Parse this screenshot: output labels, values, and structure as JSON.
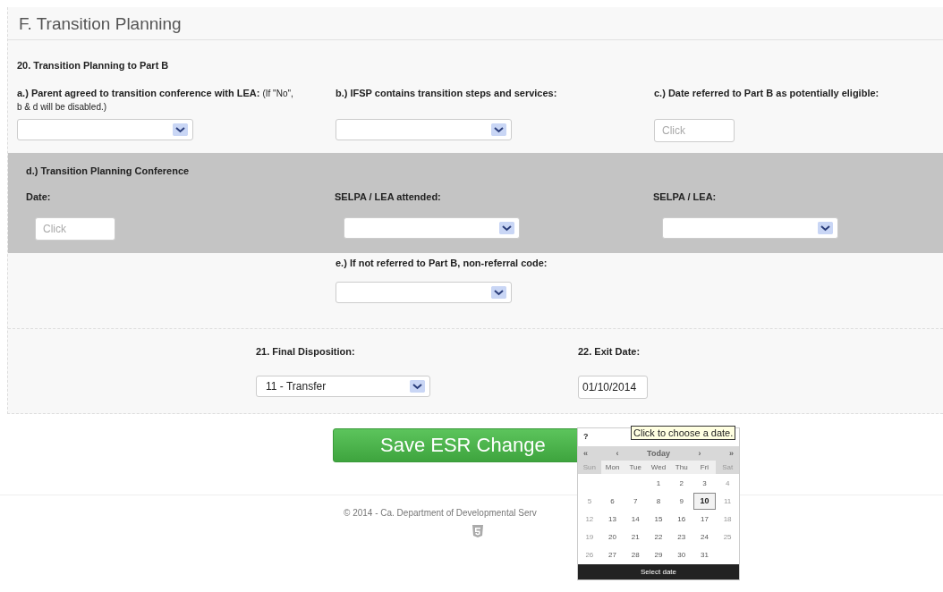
{
  "section_title": "F. Transition Planning",
  "question_20": {
    "title": "20. Transition Planning to Part B",
    "fields": [
      {
        "kind": "select",
        "label": "a.) Parent agreed to transition conference with LEA:",
        "note": "(If \"No\", b & d will be disabled.)"
      },
      {
        "kind": "select",
        "label": "b.) IFSP contains transition steps and services:"
      },
      {
        "kind": "date",
        "label": "c.) Date referred to Part B as potentially eligible:",
        "placeholder": "Click"
      }
    ]
  },
  "conference": {
    "title": "d.) Transition Planning Conference",
    "fields": [
      {
        "kind": "date",
        "label": "Date:",
        "placeholder": "Click"
      },
      {
        "kind": "select",
        "label": "SELPA / LEA attended:"
      },
      {
        "kind": "select",
        "label": "SELPA / LEA:"
      }
    ]
  },
  "non_referral": {
    "label": "e.) If not referred to Part B, non-referral code:"
  },
  "final_disposition": {
    "label": "21. Final Disposition:",
    "value": "11 - Transfer"
  },
  "exit_date": {
    "label": "22. Exit Date:",
    "value": "01/10/2014"
  },
  "save_button": "Save ESR Change",
  "footer": "© 2014 - Ca. Department of Developmental Serv",
  "tooltip": "Click to choose a date.",
  "calendar": {
    "help": "?",
    "nav": [
      "«",
      "‹",
      "Today",
      "›",
      "»"
    ],
    "weekdays": [
      {
        "label": "Sun",
        "weekend": true
      },
      {
        "label": "Mon",
        "weekend": false
      },
      {
        "label": "Tue",
        "weekend": false
      },
      {
        "label": "Wed",
        "weekend": false
      },
      {
        "label": "Thu",
        "weekend": false
      },
      {
        "label": "Fri",
        "weekend": false
      },
      {
        "label": "Sat",
        "weekend": true
      }
    ],
    "weeks": [
      {
        "days": [
          {
            "day": "1",
            "selected": false
          },
          {
            "day": "2",
            "selected": false
          },
          {
            "day": "3",
            "selected": false
          },
          {
            "day": "4",
            "selected": false
          }
        ]
      },
      {
        "days": [
          {
            "day": "5",
            "selected": false
          },
          {
            "day": "6",
            "selected": false
          },
          {
            "day": "7",
            "selected": false
          },
          {
            "day": "8",
            "selected": false
          },
          {
            "day": "9",
            "selected": false
          },
          {
            "day": "10",
            "selected": true
          },
          {
            "day": "11",
            "selected": false
          }
        ]
      },
      {
        "days": [
          {
            "day": "12",
            "selected": false
          },
          {
            "day": "13",
            "selected": false
          },
          {
            "day": "14",
            "selected": false
          },
          {
            "day": "15",
            "selected": false
          },
          {
            "day": "16",
            "selected": false
          },
          {
            "day": "17",
            "selected": false
          },
          {
            "day": "18",
            "selected": false
          }
        ]
      },
      {
        "days": [
          {
            "day": "19",
            "selected": false
          },
          {
            "day": "20",
            "selected": false
          },
          {
            "day": "21",
            "selected": false
          },
          {
            "day": "22",
            "selected": false
          },
          {
            "day": "23",
            "selected": false
          },
          {
            "day": "24",
            "selected": false
          },
          {
            "day": "25",
            "selected": false
          }
        ]
      },
      {
        "days": [
          {
            "day": "26",
            "selected": false
          },
          {
            "day": "27",
            "selected": false
          },
          {
            "day": "28",
            "selected": false
          },
          {
            "day": "29",
            "selected": false
          },
          {
            "day": "30",
            "selected": false
          },
          {
            "day": "31",
            "selected": false
          }
        ]
      }
    ],
    "footer": "Select date"
  }
}
